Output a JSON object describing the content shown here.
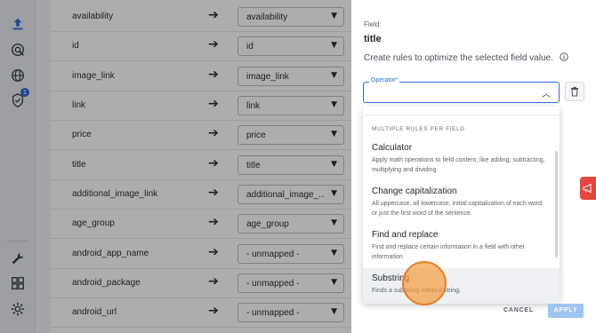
{
  "rail": {
    "icons": [
      "upload-icon",
      "radar-search-icon",
      "globe-icon",
      "shield-check-icon",
      "wrench-icon",
      "dashboard-icon",
      "settings-icon"
    ],
    "badge_count": "1"
  },
  "mappings": [
    {
      "field": "availability",
      "value": "availability"
    },
    {
      "field": "id",
      "value": "id"
    },
    {
      "field": "image_link",
      "value": "image_link"
    },
    {
      "field": "link",
      "value": "link"
    },
    {
      "field": "price",
      "value": "price"
    },
    {
      "field": "title",
      "value": "title"
    },
    {
      "field": "additional_image_link",
      "value": "additional_image_..."
    },
    {
      "field": "age_group",
      "value": "age_group"
    },
    {
      "field": "android_app_name",
      "value": "- unmapped -"
    },
    {
      "field": "android_package",
      "value": "- unmapped -"
    },
    {
      "field": "android_url",
      "value": "- unmapped -"
    }
  ],
  "drawer": {
    "field_label": "Field:",
    "field_value": "title",
    "description": "Create rules to optimize the selected field value.",
    "operator_label": "Operator*",
    "dropdown": {
      "heading": "MULTIPLE RULES PER FIELD",
      "options": [
        {
          "title": "Calculator",
          "desc": "Apply math operations to field content, like adding, subtracting, multiplying and dividing."
        },
        {
          "title": "Change capitalization",
          "desc": "All uppercase, all lowercase, initial capitalization of each word, or just the first word of the sentence."
        },
        {
          "title": "Find and replace",
          "desc": "Find and replace certain information in a field with other information."
        },
        {
          "title": "Substring",
          "desc": "Finds a substring within a string."
        }
      ]
    },
    "cancel_label": "CANCEL",
    "apply_label": "APPLY"
  },
  "colors": {
    "accent": "#2b6cd6",
    "apply_disabled": "#9ec4f3",
    "feedback": "#e8433c",
    "cursor_highlight": "#f59b3c"
  }
}
